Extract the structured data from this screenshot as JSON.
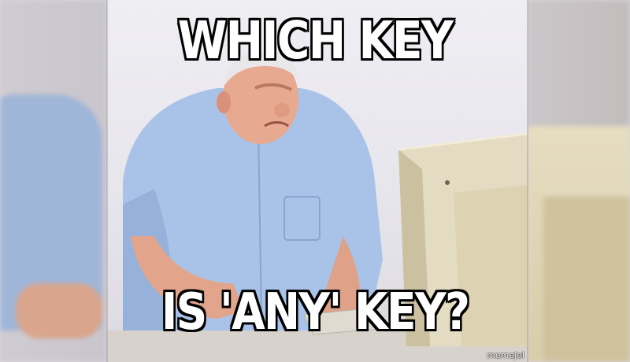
{
  "meme": {
    "top_text": "WHICH KEY",
    "bottom_text": "IS 'ANY' KEY?",
    "watermark": "memejel"
  },
  "colors": {
    "shirt": "#a9c3e8",
    "skin": "#e7a98f",
    "monitor": "#e4dcc2",
    "background": "#ecebf0",
    "caption_fill": "#ffffff",
    "caption_stroke": "#000000"
  }
}
